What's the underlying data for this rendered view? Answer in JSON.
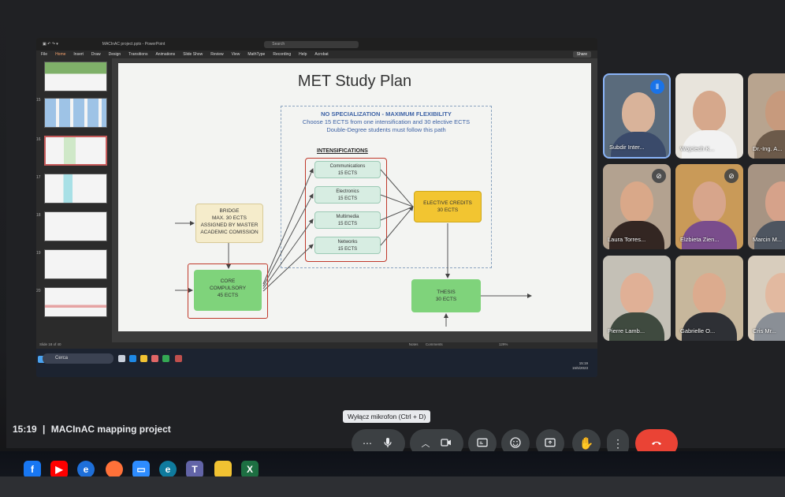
{
  "meeting": {
    "time": "15:19",
    "separator": "|",
    "title": "MACInAC mapping project",
    "mic_tooltip": "Wyłącz mikrofon (Ctrl + D)"
  },
  "ppt": {
    "title_bar": "MACInAC project.pptx - PowerPoint",
    "search_placeholder": "Search",
    "ribbon_tabs": [
      "File",
      "Home",
      "Insert",
      "Draw",
      "Design",
      "Transitions",
      "Animations",
      "Slide Show",
      "Review",
      "View",
      "MathType",
      "Recording",
      "Help",
      "Acrobat"
    ],
    "share_label": "Share",
    "status_text": "Slide 18 of 40",
    "notes_label": "Notes",
    "comments_label": "Comments",
    "zoom": "129%",
    "taskbar_search": "Cerca",
    "clock_time": "15:19",
    "clock_date": "15/5/2023",
    "thumb_numbers": [
      "15",
      "16",
      "17",
      "18",
      "19",
      "20",
      "21"
    ]
  },
  "slide": {
    "title": "MET Study Plan",
    "note_lead": "NO SPECIALIZATION - MAXIMUM FLEXIBILITY",
    "note_line2": "Choose 15 ECTS from one intensification and 30 elective ECTS",
    "note_line3": "Double-Degree students must follow this path",
    "intensifications_label": "INTENSIFICATIONS",
    "intensifications": [
      {
        "name": "Communications",
        "ects": "15 ECTS"
      },
      {
        "name": "Electronics",
        "ects": "15 ECTS"
      },
      {
        "name": "Multimedia",
        "ects": "15 ECTS"
      },
      {
        "name": "Networks",
        "ects": "15 ECTS"
      }
    ],
    "bridge": {
      "line1": "BRIDGE",
      "line2": "MAX. 30 ECTS",
      "line3": "ASSIGNED BY MASTER",
      "line4": "ACADEMIC COMISSION"
    },
    "core": {
      "line1": "CORE",
      "line2": "COMPULSORY",
      "line3": "45 ECTS"
    },
    "elective": {
      "line1": "ELECTIVE CREDITS",
      "line2": "30 ECTS"
    },
    "thesis": {
      "line1": "THESIS",
      "line2": "30 ECTS"
    }
  },
  "participants": [
    {
      "name": "Subdir Inter...",
      "speaking": true
    },
    {
      "name": "Wojciech K...",
      "speaking": false
    },
    {
      "name": "Dr.-Ing. A...",
      "speaking": false
    },
    {
      "name": "Laura Torres...",
      "speaking": false
    },
    {
      "name": "Elżbieta Zien...",
      "speaking": false
    },
    {
      "name": "Marcin M...",
      "speaking": false
    },
    {
      "name": "Pierre Lamb...",
      "speaking": false
    },
    {
      "name": "Gabrielle O...",
      "speaking": false
    },
    {
      "name": "Cris Mr...",
      "speaking": false
    }
  ],
  "controls": [
    "more-options",
    "microphone",
    "camera",
    "captions",
    "reactions",
    "present",
    "raise-hand",
    "more-actions",
    "leave-call"
  ],
  "colors": {
    "meet_bg": "#202124",
    "control_bg": "#3c4043",
    "end_call": "#ea4335",
    "core_green": "#7fd37b",
    "elective_yellow": "#f2c531",
    "bridge_beige": "#f5eccb",
    "intens_mint": "#d7ede2",
    "outline_red": "#c0392b",
    "note_blue": "#3d62a5"
  }
}
